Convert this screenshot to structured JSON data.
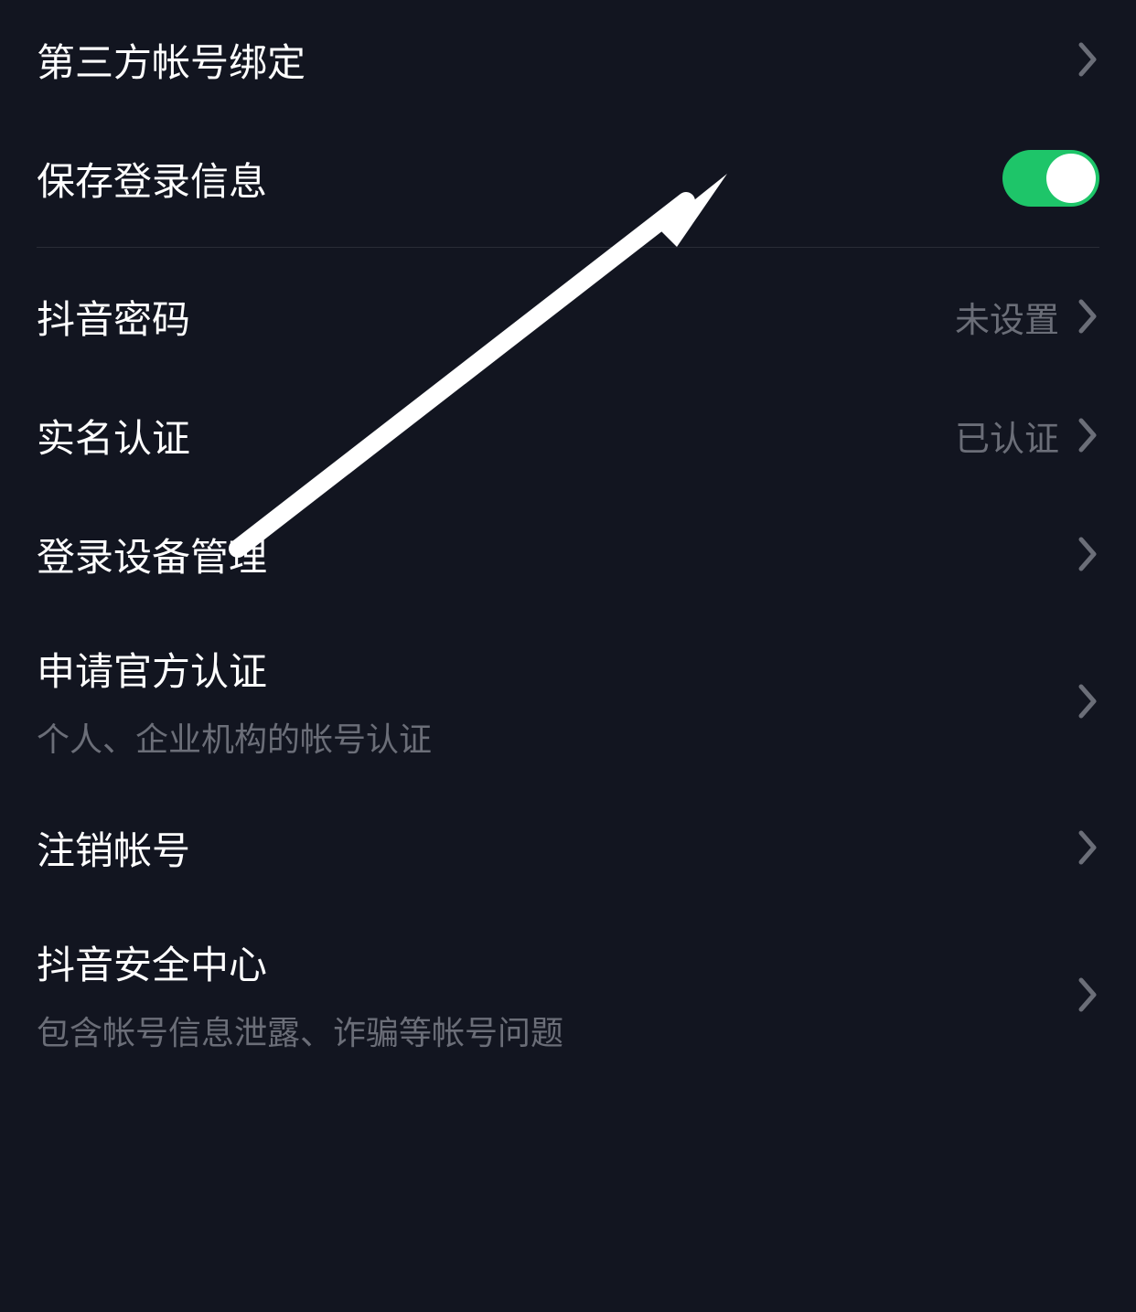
{
  "settings": {
    "thirdPartyBinding": {
      "label": "第三方帐号绑定"
    },
    "saveLoginInfo": {
      "label": "保存登录信息",
      "enabled": true
    },
    "douyinPassword": {
      "label": "抖音密码",
      "value": "未设置"
    },
    "realNameAuth": {
      "label": "实名认证",
      "value": "已认证"
    },
    "loginDevices": {
      "label": "登录设备管理"
    },
    "officialCert": {
      "label": "申请官方认证",
      "subtitle": "个人、企业机构的帐号认证"
    },
    "deleteAccount": {
      "label": "注销帐号"
    },
    "securityCenter": {
      "label": "抖音安全中心",
      "subtitle": "包含帐号信息泄露、诈骗等帐号问题"
    }
  }
}
